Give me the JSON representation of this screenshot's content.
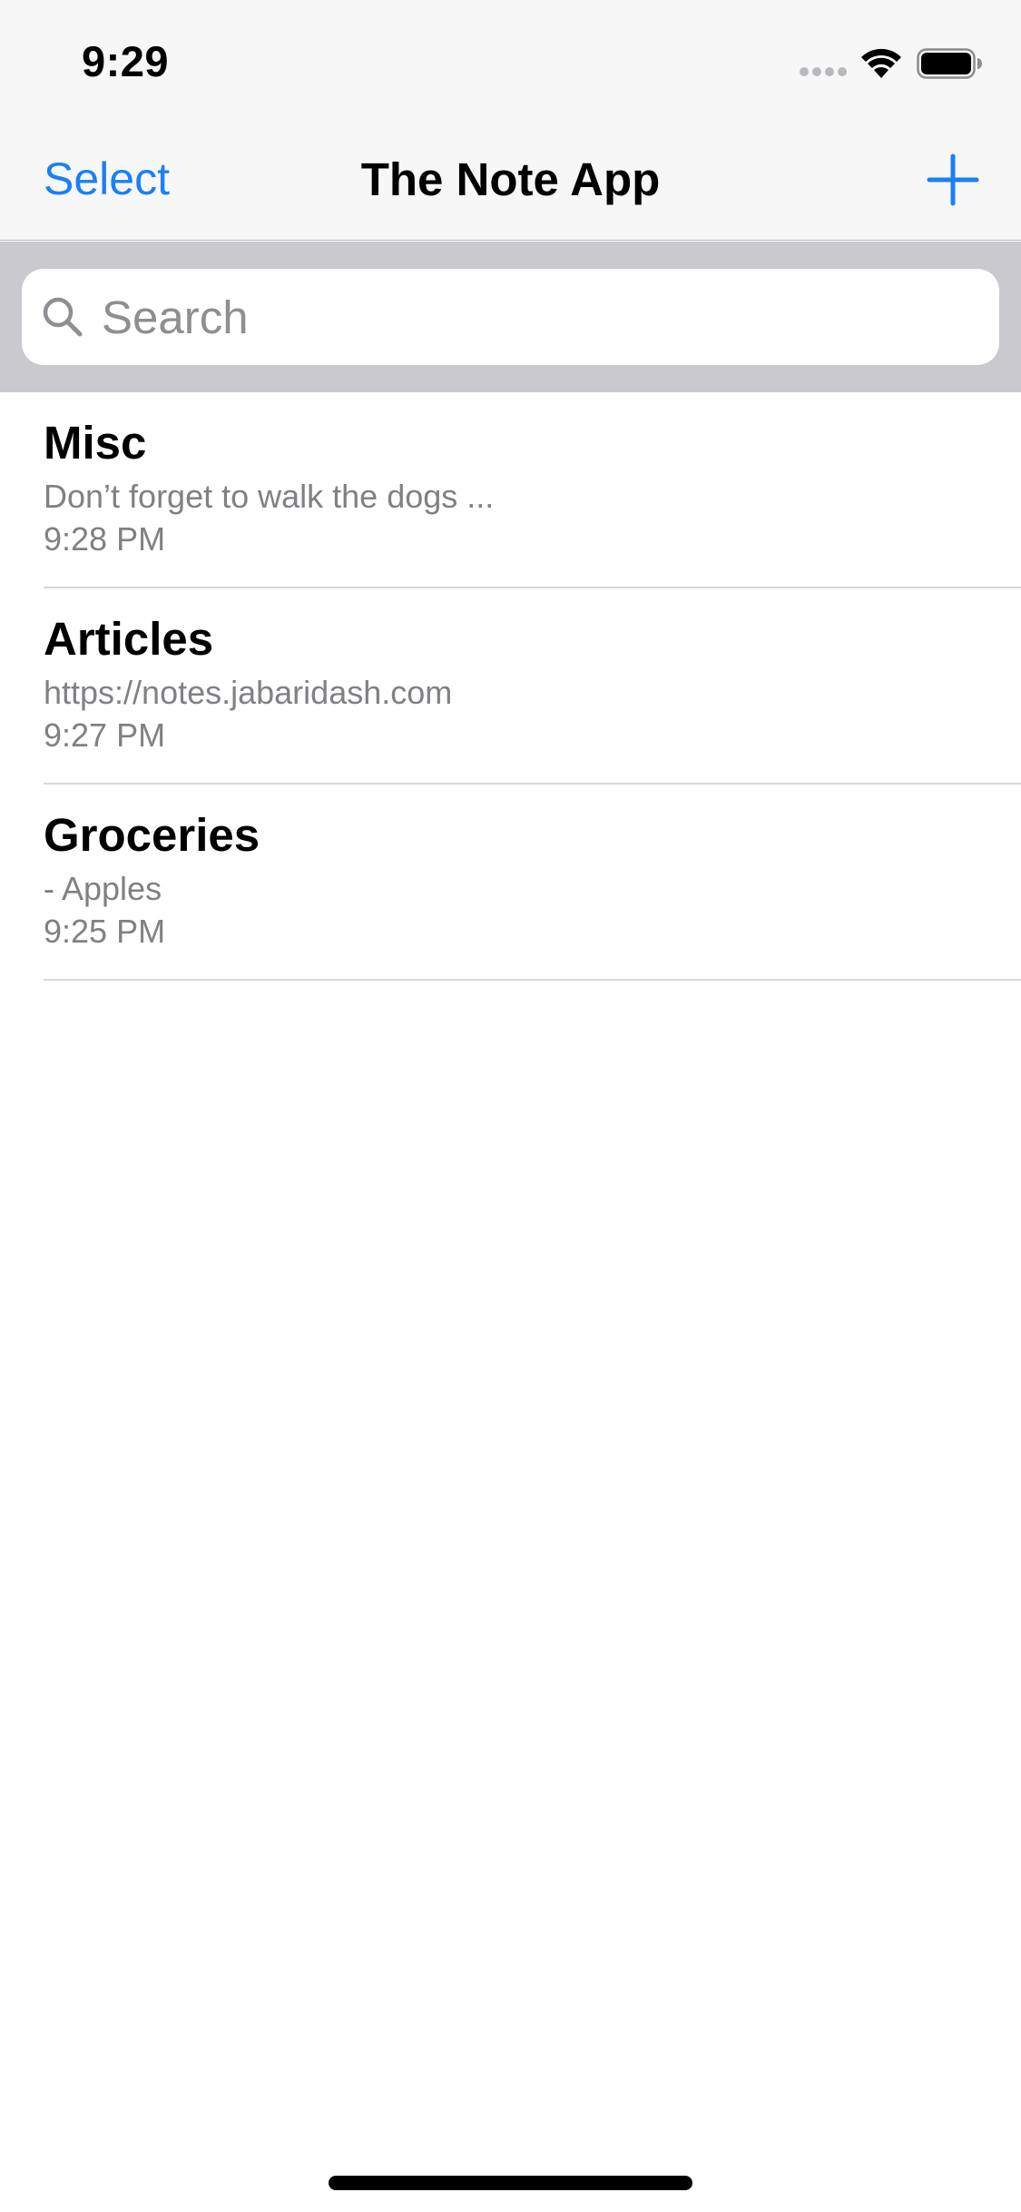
{
  "status_bar": {
    "time": "9:29",
    "icons": [
      "cellular-signal-icon",
      "wifi-icon",
      "battery-icon"
    ]
  },
  "nav_bar": {
    "left_button_label": "Select",
    "title": "The Note App",
    "right_button_icon": "plus-icon"
  },
  "search": {
    "placeholder": "Search",
    "value": "",
    "icon": "magnifying-glass-icon"
  },
  "notes": [
    {
      "title": "Misc",
      "preview": "Don’t forget to walk the dogs ...",
      "time": "9:28 PM"
    },
    {
      "title": "Articles",
      "preview": "https://notes.jabaridash.com",
      "time": "9:27 PM"
    },
    {
      "title": "Groceries",
      "preview": "- Apples",
      "time": "9:25 PM"
    }
  ],
  "colors": {
    "accent": "#1b7ff5",
    "bar_background": "#f7f7f7",
    "search_band": "#c9c9ce",
    "secondary_text": "#808085",
    "separator": "#d8d8dc"
  }
}
